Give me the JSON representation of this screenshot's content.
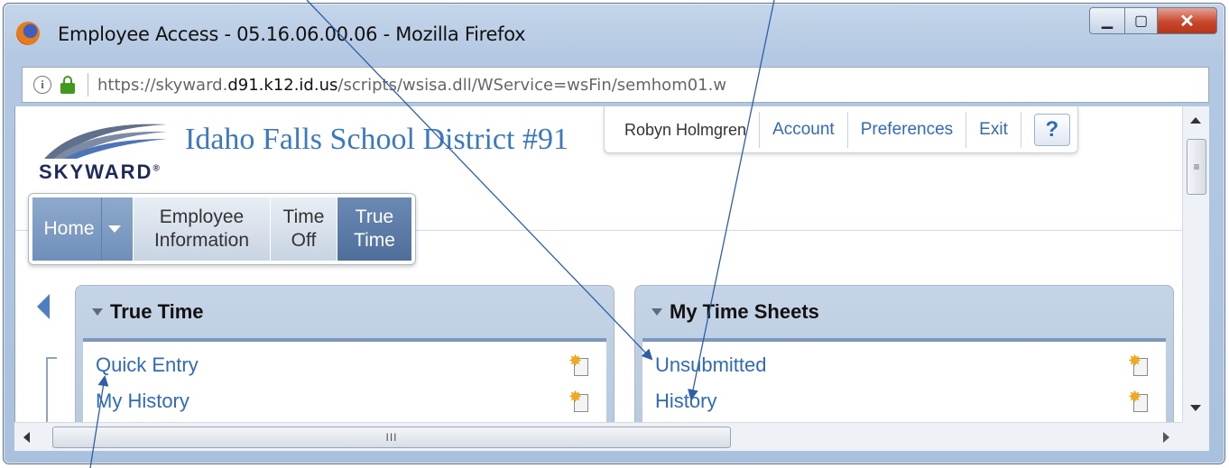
{
  "window": {
    "title": "Employee Access - 05.16.06.00.06 - Mozilla Firefox",
    "minimize_glyph": "▁",
    "maximize_glyph": "▢",
    "close_glyph": "✕"
  },
  "urlbar": {
    "info_glyph": "i",
    "url_prefix": "https://skyward.",
    "url_domain": "d91.k12.id.us",
    "url_path": "/scripts/wsisa.dll/WService=wsFin/semhom01.w"
  },
  "header": {
    "logo_text": "SKYWARD",
    "logo_mark": "®",
    "district_title": "Idaho Falls School District #91"
  },
  "usernav": {
    "user": "Robyn Holmgren",
    "account": "Account",
    "preferences": "Preferences",
    "exit": "Exit",
    "help": "?"
  },
  "tabs": {
    "home": "Home",
    "employee_line1": "Employee",
    "employee_line2": "Information",
    "timeoff_line1": "Time",
    "timeoff_line2": "Off",
    "truetime_line1": "True",
    "truetime_line2": "Time",
    "active_tab": "True Time"
  },
  "panels": {
    "true_time": {
      "title": "True Time",
      "items": [
        "Quick Entry",
        "My History"
      ]
    },
    "my_time_sheets": {
      "title": "My Time Sheets",
      "items": [
        "Unsubmitted",
        "History"
      ]
    }
  },
  "scrollbar": {
    "vthumb_grip": "≡",
    "hthumb_grip": "III"
  },
  "colors": {
    "link": "#2e6bb8",
    "active_tab": "#4f6f9b",
    "panel_header": "#c5d4e6",
    "annotation_line": "#2d5fa8"
  }
}
